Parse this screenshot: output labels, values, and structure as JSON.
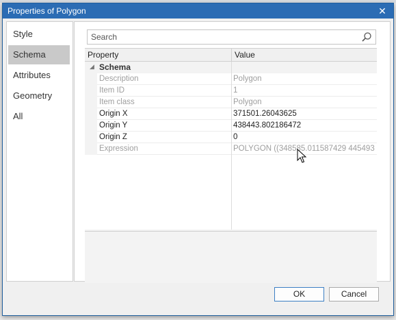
{
  "window": {
    "title": "Properties of Polygon",
    "close_glyph": "✕"
  },
  "sidebar": {
    "items": [
      {
        "label": "Style"
      },
      {
        "label": "Schema",
        "selected": true
      },
      {
        "label": "Attributes"
      },
      {
        "label": "Geometry"
      },
      {
        "label": "All"
      }
    ]
  },
  "search": {
    "placeholder": "Search",
    "value": ""
  },
  "grid": {
    "columns": {
      "property": "Property",
      "value": "Value"
    },
    "group": {
      "label": "Schema",
      "expander": "◢"
    },
    "rows": [
      {
        "name": "Description",
        "value": "Polygon",
        "enabled": false
      },
      {
        "name": "Item ID",
        "value": "1",
        "enabled": false
      },
      {
        "name": "Item class",
        "value": "Polygon",
        "enabled": false
      },
      {
        "name": "Origin X",
        "value": "371501.26043625",
        "enabled": true
      },
      {
        "name": "Origin Y",
        "value": "438443.802186472",
        "enabled": true
      },
      {
        "name": "Origin Z",
        "value": "0",
        "enabled": true
      },
      {
        "name": "Expression",
        "value": "POLYGON ((348585.011587429 445493...",
        "enabled": false
      }
    ]
  },
  "buttons": {
    "ok": "OK",
    "cancel": "Cancel"
  },
  "colors": {
    "titlebar": "#2b6cb4",
    "selected_nav": "#c9c9c9",
    "disabled_text": "#9e9e9e"
  }
}
